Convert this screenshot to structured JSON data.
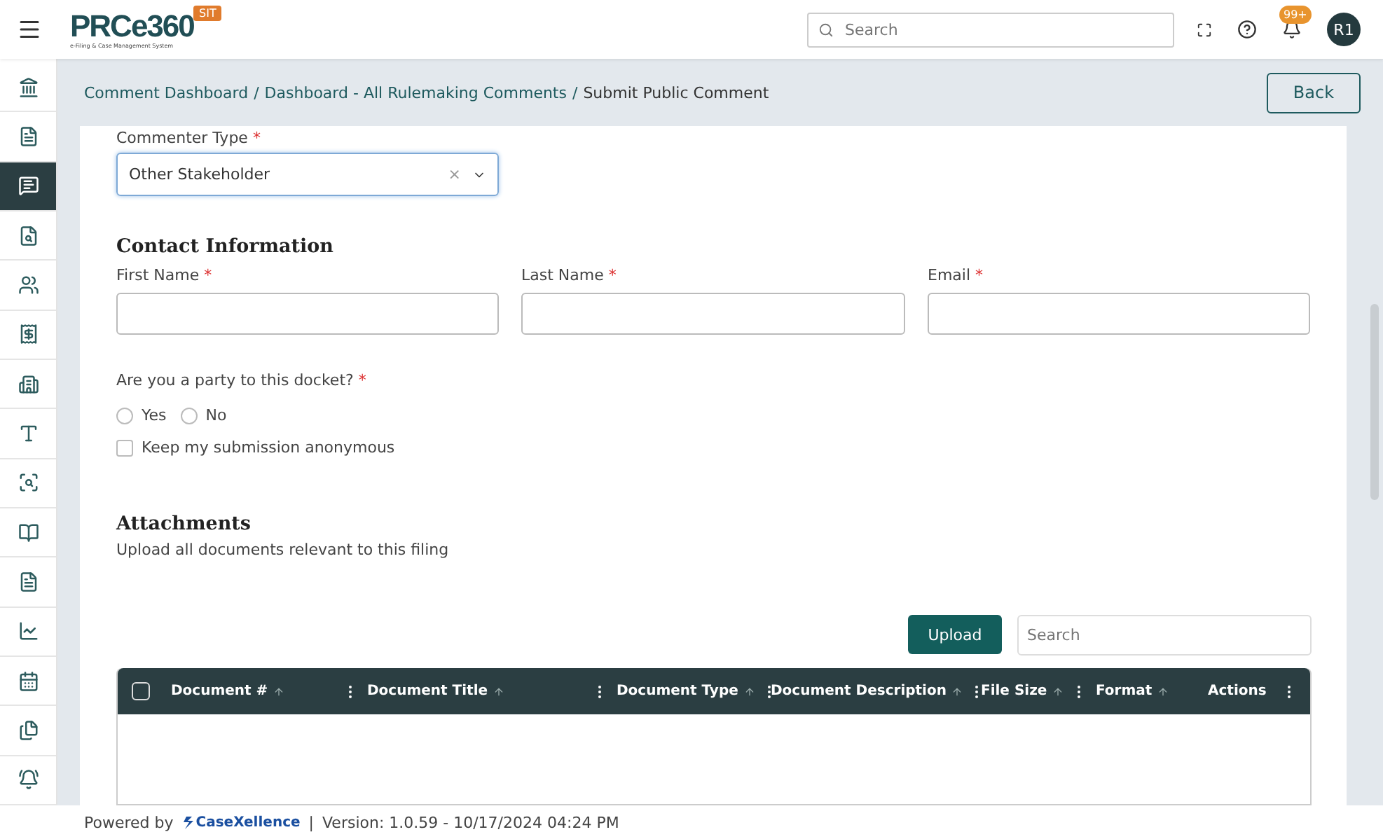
{
  "header": {
    "logo": "PRCe360",
    "logo_subtitle": "e-Filing & Case Management System",
    "env_badge": "SIT",
    "search": {
      "placeholder": "Search"
    },
    "notification_count": "99+",
    "avatar": "R1"
  },
  "sidebar": {
    "items": [
      {
        "selected": false
      },
      {
        "selected": false
      },
      {
        "selected": true
      },
      {
        "selected": false
      },
      {
        "selected": false
      },
      {
        "selected": false
      },
      {
        "selected": false
      },
      {
        "selected": false
      },
      {
        "selected": false
      },
      {
        "selected": false
      },
      {
        "selected": false
      },
      {
        "selected": false
      },
      {
        "selected": false
      },
      {
        "selected": false
      },
      {
        "selected": false
      }
    ]
  },
  "breadcrumb": [
    "Comment Dashboard",
    "Dashboard - All Rulemaking Comments",
    "Submit Public Comment"
  ],
  "breadcrumb_separator": "/",
  "back_button": "Back",
  "form": {
    "commenter_type": {
      "label": "Commenter Type",
      "required": "*",
      "value": "Other Stakeholder",
      "clear": "×"
    },
    "contact_heading": "Contact Information",
    "fields": [
      {
        "label": "First Name",
        "required": "*"
      },
      {
        "label": "Last Name",
        "required": "*"
      },
      {
        "label": "Email",
        "required": "*"
      }
    ],
    "party_question": {
      "label": "Are you a party to this docket?",
      "required": "*",
      "options": [
        {
          "label": "Yes",
          "selected": false
        },
        {
          "label": "No",
          "selected": false
        }
      ]
    },
    "anonymous": {
      "label": "Keep my submission anonymous",
      "checked": false
    }
  },
  "attachments": {
    "heading": "Attachments",
    "subtitle": "Upload all documents relevant to this filing",
    "upload_button": "Upload",
    "search": {
      "placeholder": "Search"
    },
    "table": {
      "select_all_checked": false,
      "columns": [
        {
          "label": "Document #",
          "sortable": true,
          "menu": true
        },
        {
          "label": "Document Title",
          "sortable": true,
          "menu": true
        },
        {
          "label": "Document Type",
          "sortable": true,
          "menu": true
        },
        {
          "label": "Document Description",
          "sortable": true,
          "menu": true
        },
        {
          "label": "File Size",
          "sortable": true,
          "menu": true
        },
        {
          "label": "Format",
          "sortable": true,
          "menu": false
        },
        {
          "label": "Actions",
          "sortable": false,
          "menu": true
        }
      ]
    }
  },
  "footer": {
    "powered_by": "Powered by",
    "brand": "CaseXellence",
    "separator": "|",
    "version": "Version: 1.0.59 - 10/17/2024 04:24 PM"
  }
}
